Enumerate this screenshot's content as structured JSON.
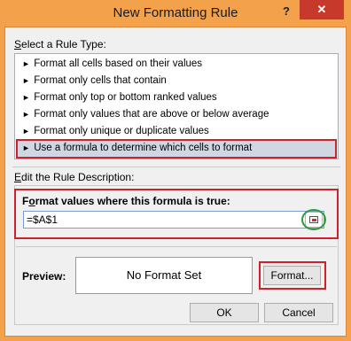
{
  "dialog": {
    "title": "New Formatting Rule",
    "help_label": "?",
    "close_label": "✕"
  },
  "rule_type": {
    "label_prefix": "",
    "label_underlined": "S",
    "label_rest": "elect a Rule Type:",
    "items": [
      {
        "label": "Format all cells based on their values"
      },
      {
        "label": "Format only cells that contain"
      },
      {
        "label": "Format only top or bottom ranked values"
      },
      {
        "label": "Format only values that are above or below average"
      },
      {
        "label": "Format only unique or duplicate values"
      },
      {
        "label": "Use a formula to determine which cells to format"
      }
    ],
    "selected_index": 5,
    "bullet": "►"
  },
  "description": {
    "label_underlined": "E",
    "label_rest": "dit the Rule Description:",
    "formula_heading_underlined": "o",
    "formula_heading_pre": "F",
    "formula_heading_post": "rmat values where this formula is true:",
    "formula_value": "=$A$1",
    "preview_label": "Preview:",
    "preview_text": "No Format Set",
    "format_button": "Format..."
  },
  "buttons": {
    "ok": "OK",
    "cancel": "Cancel"
  },
  "colors": {
    "title_bar": "#f3a14b",
    "close_button": "#c7392b",
    "highlight_red": "#d0202b",
    "highlight_green": "#2e9c3a",
    "selected_row": "#cfd7e3"
  }
}
